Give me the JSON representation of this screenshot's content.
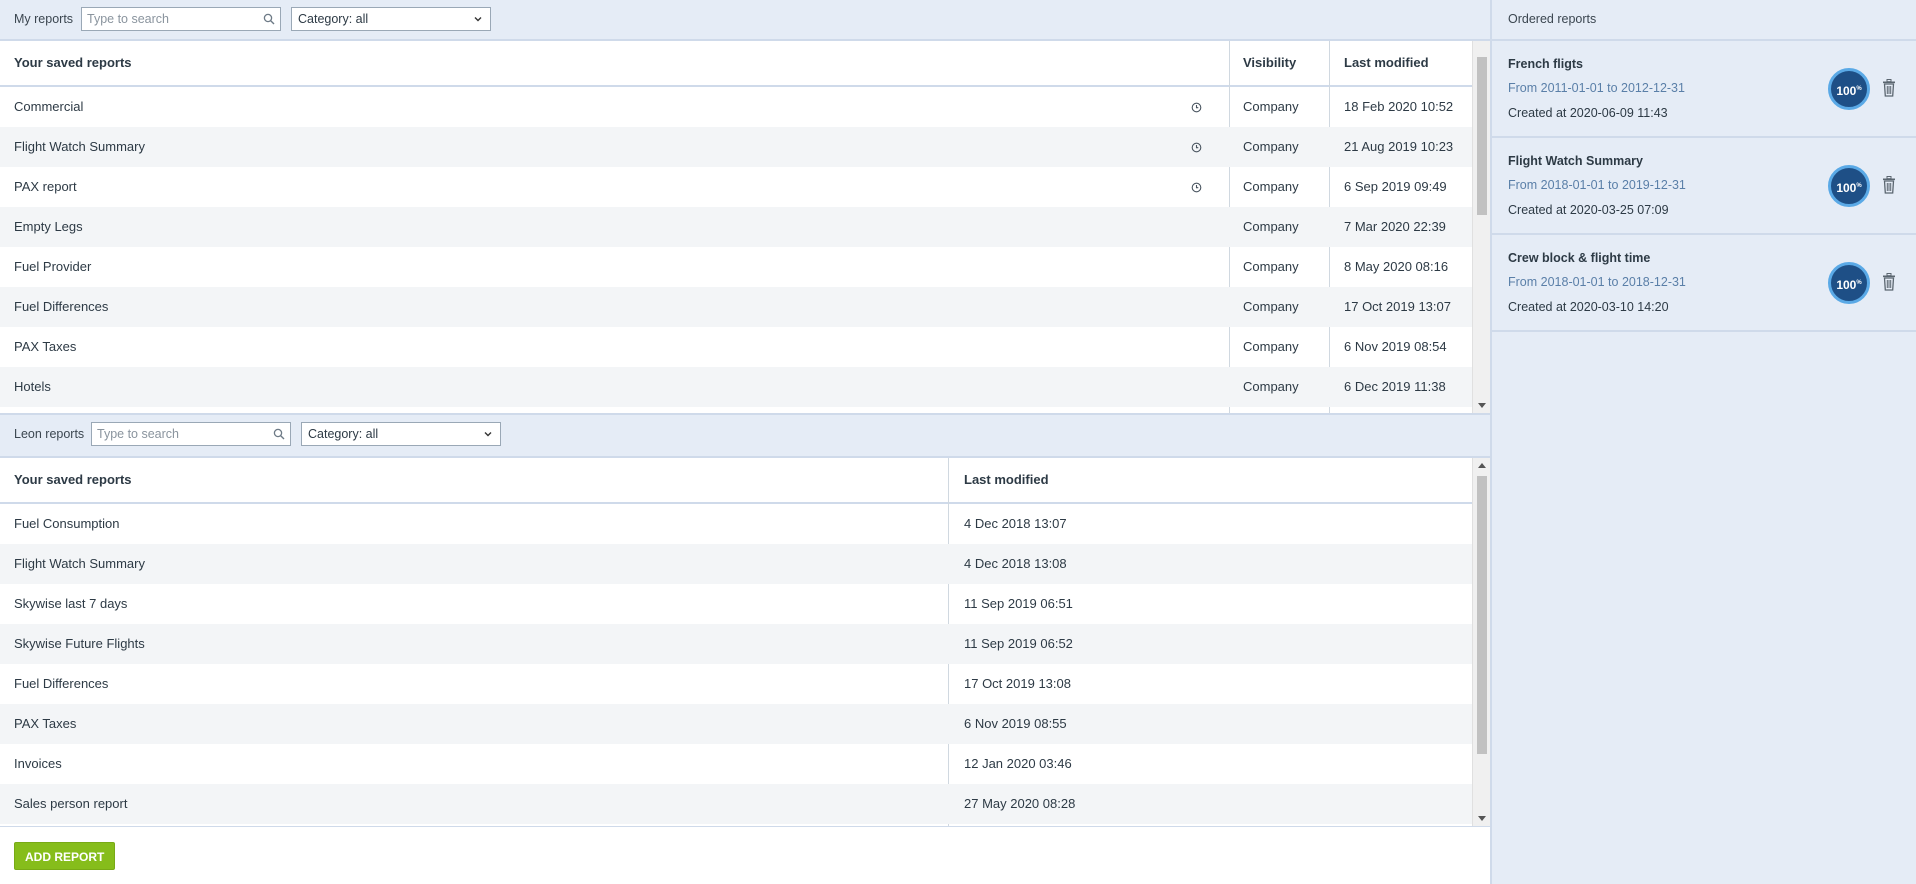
{
  "my_reports": {
    "label": "My reports",
    "search_placeholder": "Type to search",
    "category": "Category: all",
    "columns": [
      "Your saved reports",
      "Visibility",
      "Last modified"
    ],
    "rows": [
      {
        "name": "Commercial",
        "visibility": "Company",
        "modified": "18 Feb 2020 10:52",
        "scheduled": true
      },
      {
        "name": "Flight Watch Summary",
        "visibility": "Company",
        "modified": "21 Aug 2019 10:23",
        "scheduled": true
      },
      {
        "name": "PAX report",
        "visibility": "Company",
        "modified": "6 Sep 2019 09:49",
        "scheduled": true
      },
      {
        "name": "Empty Legs",
        "visibility": "Company",
        "modified": "7 Mar 2020 22:39",
        "scheduled": false
      },
      {
        "name": "Fuel Provider",
        "visibility": "Company",
        "modified": "8 May 2020 08:16",
        "scheduled": false
      },
      {
        "name": "Fuel Differences",
        "visibility": "Company",
        "modified": "17 Oct 2019 13:07",
        "scheduled": false
      },
      {
        "name": "PAX Taxes",
        "visibility": "Company",
        "modified": "6 Nov 2019 08:54",
        "scheduled": false
      },
      {
        "name": "Hotels",
        "visibility": "Company",
        "modified": "6 Dec 2019 11:38",
        "scheduled": false
      }
    ]
  },
  "leon_reports": {
    "label": "Leon reports",
    "search_placeholder": "Type to search",
    "category": "Category: all",
    "columns": [
      "Your saved reports",
      "Last modified"
    ],
    "rows": [
      {
        "name": "Fuel Consumption",
        "modified": "4 Dec 2018 13:07"
      },
      {
        "name": "Flight Watch Summary",
        "modified": "4 Dec 2018 13:08"
      },
      {
        "name": "Skywise last 7 days",
        "modified": "11 Sep 2019 06:51"
      },
      {
        "name": "Skywise Future Flights",
        "modified": "11 Sep 2019 06:52"
      },
      {
        "name": "Fuel Differences",
        "modified": "17 Oct 2019 13:08"
      },
      {
        "name": "PAX Taxes",
        "modified": "6 Nov 2019 08:55"
      },
      {
        "name": "Invoices",
        "modified": "12 Jan 2020 03:46"
      },
      {
        "name": "Sales person report",
        "modified": "27 May 2020 08:28"
      }
    ]
  },
  "add_report_label": "ADD REPORT",
  "ordered_reports": {
    "title": "Ordered reports",
    "items": [
      {
        "title": "French fligts",
        "range": "From 2011-01-01 to 2012-12-31",
        "created": "Created at 2020-06-09 11:43",
        "progress": "100"
      },
      {
        "title": "Flight Watch Summary",
        "range": "From 2018-01-01 to 2019-12-31",
        "created": "Created at 2020-03-25 07:09",
        "progress": "100"
      },
      {
        "title": "Crew block & flight time",
        "range": "From 2018-01-01 to 2018-12-31",
        "created": "Created at 2020-03-10 14:20",
        "progress": "100"
      }
    ]
  },
  "icons": {
    "search": "search-icon",
    "dropdown": "chevron-down-icon",
    "schedule": "clock-icon",
    "delete": "trash-icon"
  },
  "colors": {
    "panel_bg": "#e5ecf6",
    "accent_green": "#86bd1b",
    "progress_fill": "#1e4f86",
    "progress_ring": "#5aa9e6",
    "link_blue": "#5a7fa8"
  }
}
